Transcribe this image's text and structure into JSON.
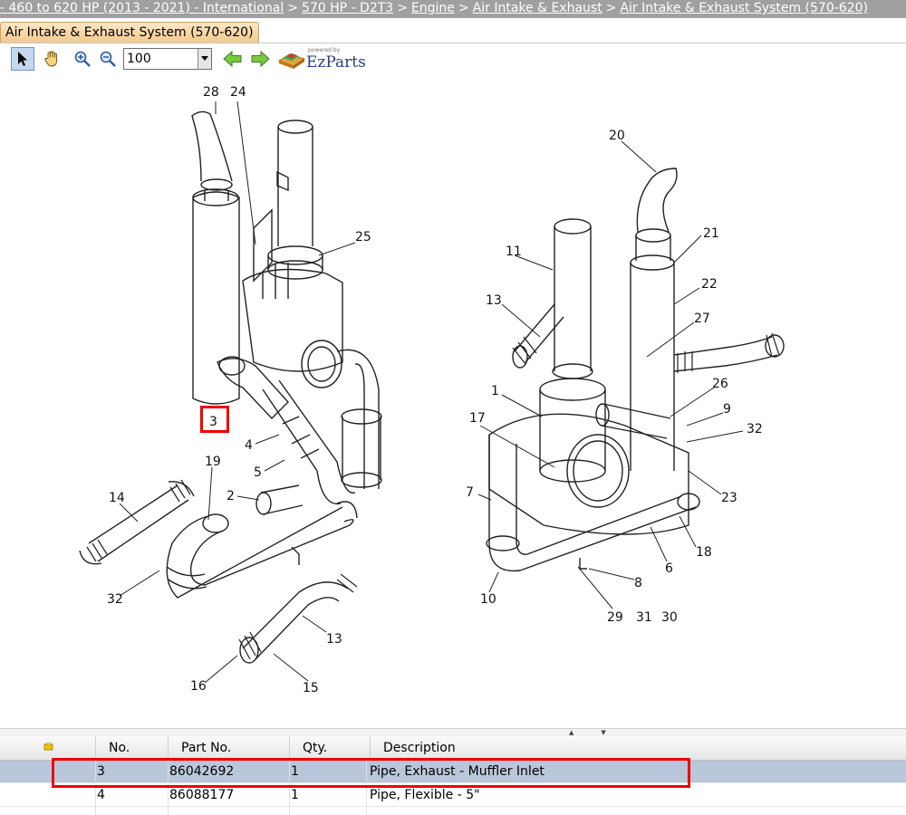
{
  "breadcrumb": {
    "items": [
      "- 460 to 620 HP (2013 - 2021) - International",
      "570 HP - D2T3",
      "Engine",
      "Air Intake & Exhaust",
      "Air Intake & Exhaust System (570-620)"
    ],
    "separator": ">"
  },
  "tab": {
    "label": "Air Intake & Exhaust System (570-620)"
  },
  "toolbar": {
    "zoom_value": "100",
    "logo_powered": "powered by",
    "logo_brand": "EzParts"
  },
  "diagram": {
    "callouts": [
      "28",
      "24",
      "25",
      "3",
      "4",
      "5",
      "2",
      "19",
      "14",
      "32",
      "13",
      "16",
      "15",
      "20",
      "11",
      "21",
      "13",
      "22",
      "27",
      "1",
      "26",
      "9",
      "17",
      "32",
      "7",
      "23",
      "18",
      "6",
      "8",
      "10",
      "29",
      "31",
      "30"
    ],
    "highlighted_callout": "3"
  },
  "grid": {
    "columns": [
      "No.",
      "Part No.",
      "Qty.",
      "Description"
    ],
    "rows": [
      {
        "no": "3",
        "part": "86042692",
        "qty": "1",
        "desc": "Pipe, Exhaust - Muffler Inlet",
        "selected": true
      },
      {
        "no": "4",
        "part": "86088177",
        "qty": "1",
        "desc": "Pipe, Flexible - 5\"",
        "selected": false
      }
    ]
  },
  "colors": {
    "highlight": "#ee0000",
    "selected_row": "#bac6d9",
    "breadcrumb_bg": "#a0a0a0"
  }
}
